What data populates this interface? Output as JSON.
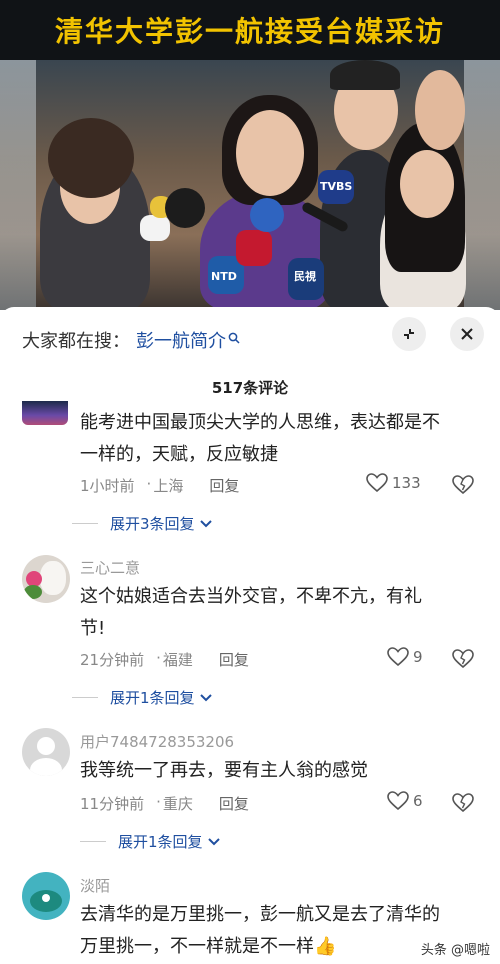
{
  "video": {
    "title": "清华大学彭一航接受台媒采访",
    "mic_labels": [
      "TVBS",
      "民視",
      "NTD"
    ]
  },
  "search": {
    "prefix": "大家都在搜：",
    "term": "彭一航简介",
    "icon": "search-icon"
  },
  "panel": {
    "comment_count": "517条评论",
    "collapse_icon": "collapse-icon",
    "close_icon": "close-icon"
  },
  "comments": [
    {
      "text_line1": "能考进中国最顶尖大学的人思维，表达都是不",
      "text_line2": "一样的，天赋，反应敏捷",
      "time": "1小时前",
      "location": "上海",
      "reply": "回复",
      "likes": "133",
      "expand": "展开3条回复"
    },
    {
      "username": "三心二意",
      "text_line1": "这个姑娘适合去当外交官，不卑不亢，有礼",
      "text_line2": "节!",
      "time": "21分钟前",
      "location": "福建",
      "reply": "回复",
      "likes": "9",
      "expand": "展开1条回复"
    },
    {
      "username": "用户7484728353206",
      "text_line1": "我等统一了再去，要有主人翁的感觉",
      "time": "11分钟前",
      "location": "重庆",
      "reply": "回复",
      "likes": "6",
      "expand": "展开1条回复"
    },
    {
      "username": "淡陌",
      "text_line1": "去清华的是万里挑一，彭一航又是去了清华的",
      "text_line2": "万里挑一，不一样就是不一样👍"
    }
  ],
  "watermark": "头条 @嗯啦",
  "colors": {
    "title_yellow": "#f2c300",
    "link_blue": "#1f4fa0"
  }
}
